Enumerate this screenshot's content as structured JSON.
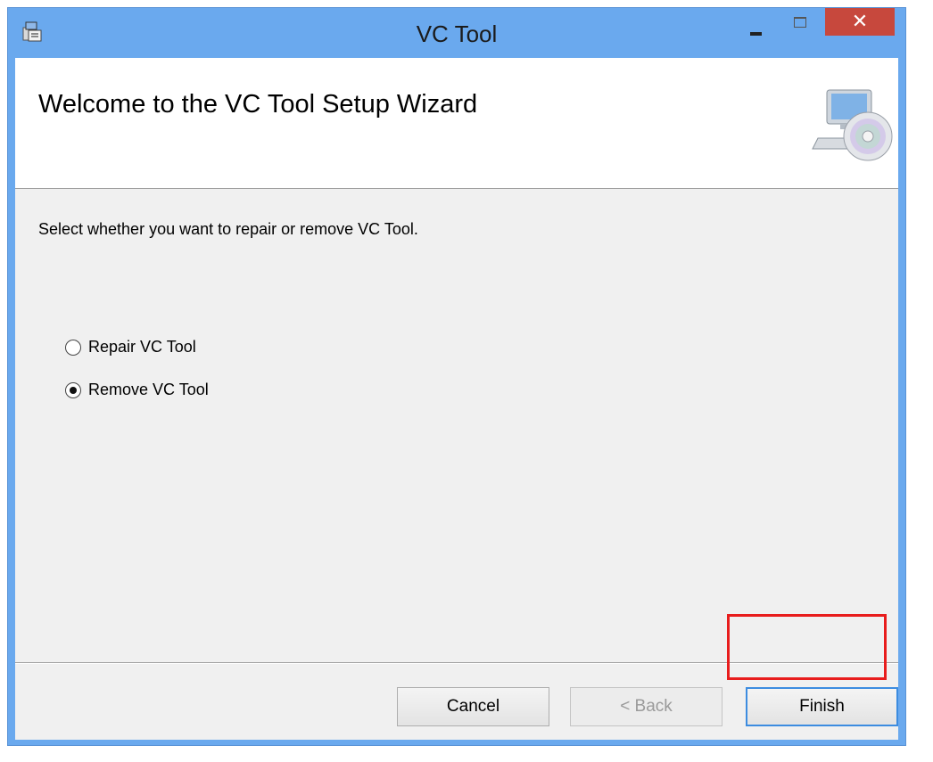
{
  "window": {
    "title": "VC Tool"
  },
  "title_bar": {
    "icons": [
      "installer-icon",
      "minimize-icon",
      "maximize-icon",
      "close-icon"
    ],
    "close_glyph": "✕"
  },
  "banner": {
    "title": "Welcome to the VC Tool Setup Wizard",
    "graphic": "computer-cd-icon"
  },
  "content": {
    "instruction": "Select whether you want to repair or remove VC Tool.",
    "options": [
      {
        "label": "Repair VC Tool",
        "selected": false
      },
      {
        "label": "Remove VC Tool",
        "selected": true
      }
    ]
  },
  "buttons": {
    "cancel": "Cancel",
    "back": "< Back",
    "finish": "Finish"
  },
  "colors": {
    "title_bar": "#6aa9ee",
    "close_button": "#c7483d",
    "highlight_box": "#e81d1d",
    "dialog_background": "#f0f0f0"
  }
}
